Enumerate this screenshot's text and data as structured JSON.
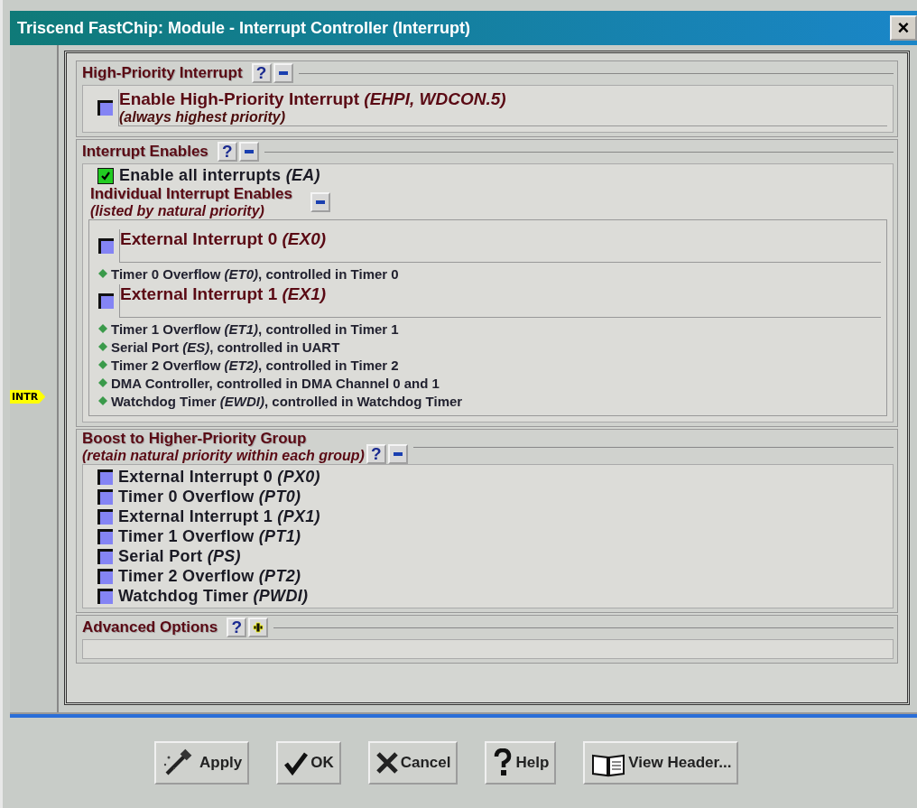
{
  "window": {
    "title": "Triscend FastChip: Module - Interrupt Controller (Interrupt)",
    "close": "×"
  },
  "side_marker": "INTR",
  "high_priority": {
    "title": "High-Priority Interrupt",
    "help": "?",
    "expanded": true,
    "option": {
      "label": "Enable High-Priority Interrupt *(EHPI, WDCON.5)*",
      "note": "(always highest priority)",
      "checked": false
    }
  },
  "interrupt_enables": {
    "title": "Interrupt Enables",
    "help": "?",
    "expanded": true,
    "enable_all": {
      "label": "Enable all interrupts *(EA)*",
      "checked": true
    },
    "individual": {
      "title": "Individual Interrupt Enables",
      "note": "(listed by natural priority)",
      "expanded": true,
      "items": [
        {
          "kind": "checkbox",
          "label": "External Interrupt 0 *(EX0)*",
          "checked": false
        },
        {
          "kind": "info",
          "text": "Timer 0 Overflow *(ET0)*, controlled in Timer 0"
        },
        {
          "kind": "checkbox",
          "label": "External Interrupt 1 *(EX1)*",
          "checked": false
        },
        {
          "kind": "info",
          "text": "Timer 1 Overflow *(ET1)*, controlled in Timer 1"
        },
        {
          "kind": "info",
          "text": "Serial Port *(ES)*, controlled in UART"
        },
        {
          "kind": "info",
          "text": "Timer 2 Overflow *(ET2)*, controlled in Timer 2"
        },
        {
          "kind": "info",
          "text": "DMA Controller, controlled in DMA Channel 0 and 1"
        },
        {
          "kind": "info",
          "text": "Watchdog Timer *(EWDI)*, controlled in Watchdog Timer"
        }
      ]
    }
  },
  "boost": {
    "title": "Boost to Higher-Priority Group",
    "note": "(retain natural priority within each group)",
    "help": "?",
    "expanded": true,
    "items": [
      {
        "label": "External Interrupt 0 *(PX0)*",
        "checked": false
      },
      {
        "label": "Timer 0 Overflow *(PT0)*",
        "checked": false
      },
      {
        "label": "External Interrupt 1 *(PX1)*",
        "checked": false
      },
      {
        "label": "Timer 1 Overflow *(PT1)*",
        "checked": false
      },
      {
        "label": "Serial Port *(PS)*",
        "checked": false
      },
      {
        "label": "Timer 2 Overflow *(PT2)*",
        "checked": false
      },
      {
        "label": "Watchdog Timer *(PWDI)*",
        "checked": false
      }
    ]
  },
  "advanced": {
    "title": "Advanced Options",
    "help": "?",
    "expanded": false
  },
  "buttons": [
    {
      "label": "Apply"
    },
    {
      "label": "OK"
    },
    {
      "label": "Cancel"
    },
    {
      "label": "Help"
    },
    {
      "label": "View Header..."
    }
  ]
}
